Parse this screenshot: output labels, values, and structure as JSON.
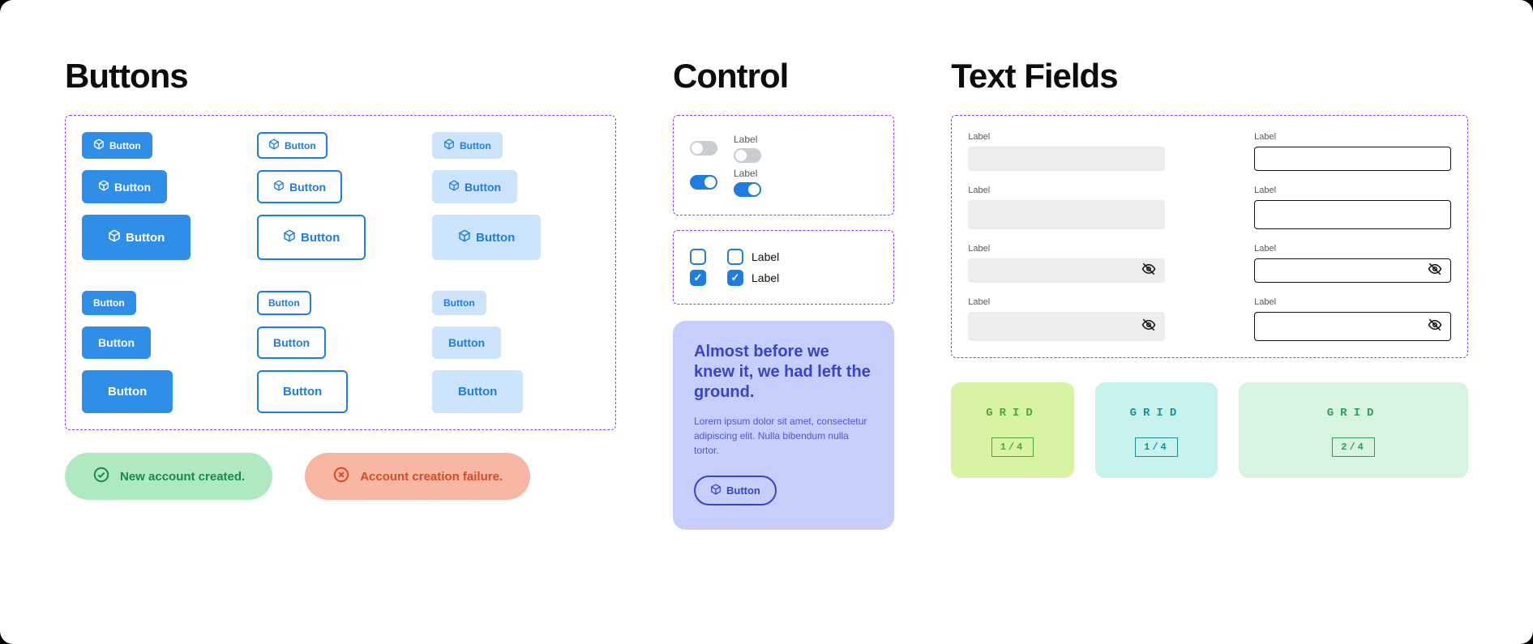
{
  "sections": {
    "buttons": "Buttons",
    "control": "Control",
    "textfields": "Text Fields"
  },
  "button_label": "Button",
  "alerts": {
    "success": "New account created.",
    "error": "Account creation failure."
  },
  "control": {
    "toggle_label_1": "Label",
    "toggle_label_2": "Label",
    "checkbox_label_1": "Label",
    "checkbox_label_2": "Label"
  },
  "card": {
    "title": "Almost before we knew it, we had left the ground.",
    "body": "Lorem ipsum dolor sit amet, consectetur adipiscing elit. Nulla bibendum nulla tortor.",
    "button": "Button"
  },
  "field_label": "Label",
  "grid": {
    "title": "GRID",
    "q1": "1/4",
    "q2": "1/4",
    "q3": "2/4"
  }
}
